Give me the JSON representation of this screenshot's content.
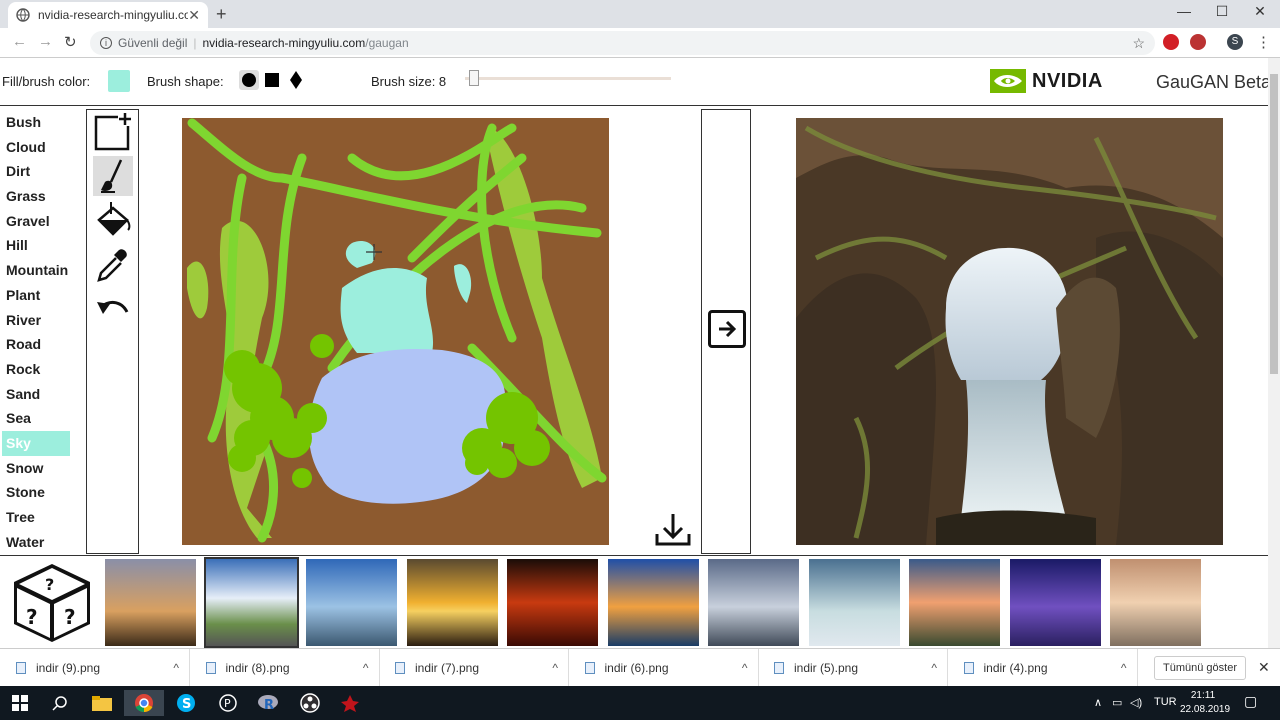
{
  "browser": {
    "tab_title": "nvidia-research-mingyuliu.com",
    "tab_close": "✕",
    "new_tab": "+",
    "minimize": "—",
    "maximize": "☐",
    "close": "✕",
    "security_label": "Güvenli değil",
    "url_host": "nvidia-research-mingyuliu.com",
    "url_path": "/gaugan",
    "profile_initial": "S"
  },
  "controls": {
    "fill_label": "Fill/brush color:",
    "fill_color": "#9ceedd",
    "shape_label": "Brush shape:",
    "size_label": "Brush size: 8",
    "size_value": 8,
    "brand_text": "NVIDIA",
    "product_name": "GauGAN Beta"
  },
  "labels": [
    {
      "label": "Bush"
    },
    {
      "label": "Cloud"
    },
    {
      "label": "Dirt"
    },
    {
      "label": "Grass"
    },
    {
      "label": "Gravel"
    },
    {
      "label": "Hill"
    },
    {
      "label": "Mountain"
    },
    {
      "label": "Plant"
    },
    {
      "label": "River"
    },
    {
      "label": "Road"
    },
    {
      "label": "Rock"
    },
    {
      "label": "Sand"
    },
    {
      "label": "Sea"
    },
    {
      "label": "Sky"
    },
    {
      "label": "Snow"
    },
    {
      "label": "Stone"
    },
    {
      "label": "Tree"
    },
    {
      "label": "Water"
    }
  ],
  "selected_label": "Sky",
  "colors": {
    "dirt": "#8d5a2f",
    "grass": "#7fd630",
    "tree": "#9ecb3b",
    "bush": "#74c400",
    "sky": "#9ceedd",
    "water": "#b0c4f6"
  },
  "downloads": [
    {
      "name": "indir (9).png"
    },
    {
      "name": "indir (8).png"
    },
    {
      "name": "indir (7).png"
    },
    {
      "name": "indir (6).png"
    },
    {
      "name": "indir (5).png"
    },
    {
      "name": "indir (4).png"
    }
  ],
  "show_all": "Tümünü göster",
  "taskbar": {
    "lang": "TUR",
    "time": "21:11",
    "date": "22.08.2019"
  }
}
